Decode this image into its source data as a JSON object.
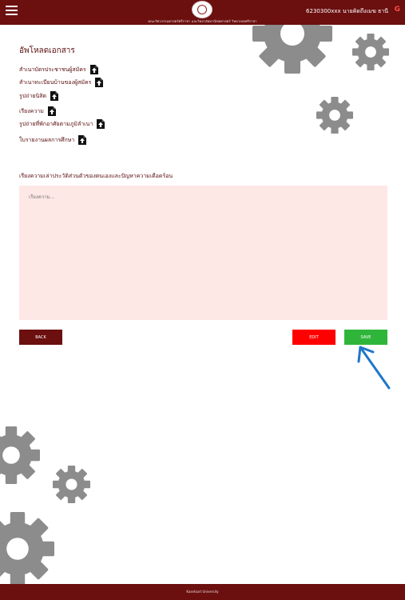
{
  "header": {
    "faculty": "คณะวิศวกรรมศาสตร์ศรีราชา และวิทยาลัยพาณิชยศาสตร์ วิทยาเขตศรีราชา",
    "user": "6230300xxx นายคิดถึงเมฆ ธานี",
    "logout_icon": "G"
  },
  "page": {
    "title": "อัพโหลดเอกสาร",
    "documents": [
      {
        "label": "สำเนาบัตรประชาชนผู้สมัคร",
        "icon": "file-upload-icon"
      },
      {
        "label": "สำเนาทะเบียนบ้านของผู้สมัคร",
        "icon": "file-upload-icon"
      },
      {
        "label": "รูปถ่ายนิสิต",
        "icon": "file-upload-icon"
      },
      {
        "label": "เรียงความ",
        "icon": "file-upload-icon"
      },
      {
        "label": "รูปถ่ายที่พักอาศัยตามภูมิลำเนา",
        "icon": "file-upload-icon"
      },
      {
        "label": "ใบรายงานผลการศึกษา",
        "icon": "file-upload-icon"
      }
    ],
    "essay_label": "เรียงความเล่าประวัติส่วนตัวของตนเองและปัญหาความเดือดร้อน",
    "essay_placeholder": "เรียงความ...",
    "essay_value": ""
  },
  "buttons": {
    "back": "BACK",
    "edit": "EDIT",
    "save": "SAVE"
  },
  "footer": {
    "text": "Kasetsart University"
  },
  "colors": {
    "brand": "#6b0f0f",
    "edit": "#ff0000",
    "save": "#2fb53a",
    "textarea_bg": "#fde8e6",
    "arrow": "#1f77c9",
    "gear": "#8c8c8c"
  }
}
